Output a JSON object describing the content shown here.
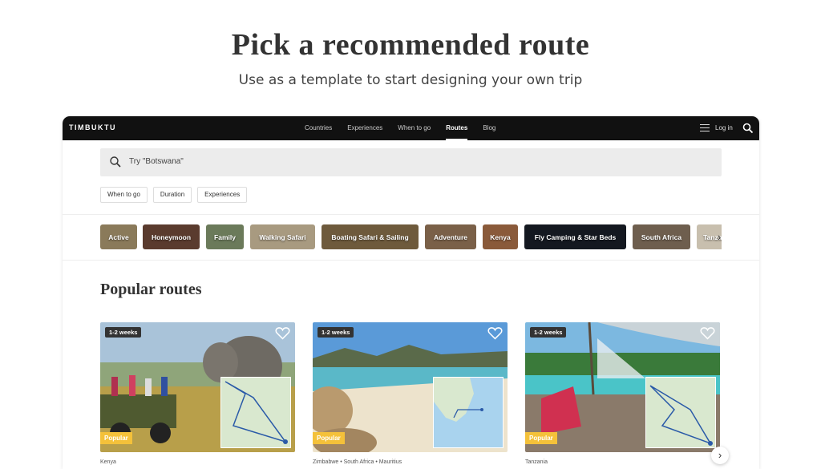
{
  "hero": {
    "title": "Pick a recommended route",
    "subtitle": "Use as a template to start designing your own trip"
  },
  "app": {
    "logo": "TIMBUKTU",
    "nav": [
      "Countries",
      "Experiences",
      "When to go",
      "Routes",
      "Blog"
    ],
    "active_nav": "Routes",
    "login": "Log in",
    "icons": {
      "menu": "hamburger-icon",
      "search": "search-icon"
    }
  },
  "search": {
    "placeholder": "Try \"Botswana\""
  },
  "filters": [
    "When to go",
    "Duration",
    "Experiences"
  ],
  "categories": [
    {
      "label": "Active",
      "color": "#8a7a5a"
    },
    {
      "label": "Honeymoon",
      "color": "#5a3b2e"
    },
    {
      "label": "Family",
      "color": "#6b7a5a"
    },
    {
      "label": "Walking Safari",
      "color": "#a89a80"
    },
    {
      "label": "Boating Safari & Sailing",
      "color": "#6e5a3c"
    },
    {
      "label": "Adventure",
      "color": "#7a6048"
    },
    {
      "label": "Kenya",
      "color": "#8a5a3a"
    },
    {
      "label": "Fly Camping & Star Beds",
      "color": "#141820"
    },
    {
      "label": "South Africa",
      "color": "#6e5e4e"
    },
    {
      "label": "Tanzania",
      "color": "#c8bfae"
    }
  ],
  "section": {
    "title": "Popular routes"
  },
  "routes": [
    {
      "duration": "1-2 weeks",
      "badge": "Popular",
      "countries": "Kenya"
    },
    {
      "duration": "1-2 weeks",
      "badge": "Popular",
      "countries": "Zimbabwe • South Africa • Mauritius"
    },
    {
      "duration": "1-2 weeks",
      "badge": "Popular",
      "countries": "Tanzania"
    }
  ],
  "colors": {
    "nav_bg": "#111111",
    "popular_badge": "#f4c13a",
    "search_bg": "#ececec"
  }
}
